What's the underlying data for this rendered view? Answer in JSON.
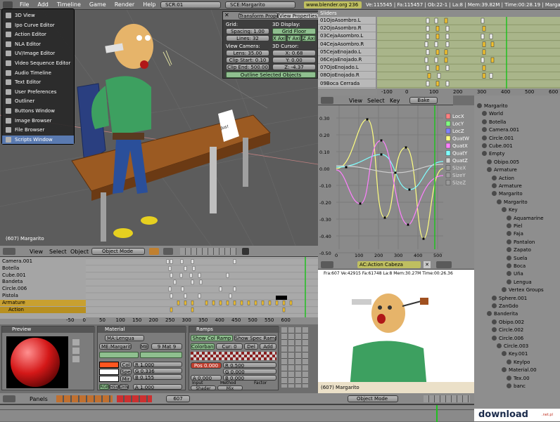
{
  "topbar": {
    "menus": [
      "File",
      "Add",
      "Timeline",
      "Game",
      "Render",
      "Help"
    ],
    "screen": "SCR:01",
    "scene": "SCE:Margarito",
    "url": "www.blender.org 236",
    "stats": "Ve:115545 | Fa:115457 | Ob:22-1 | La:8 | Mem:39.82M | Time:00:28.19 | Margarito"
  },
  "window_menu": {
    "items": [
      "3D View",
      "Ipo Curve Editor",
      "Action Editor",
      "NLA Editor",
      "UV/Image Editor",
      "Video Sequence Editor",
      "Audio Timeline",
      "Text Editor",
      "User Preferences",
      "Outliner",
      "Buttons Window",
      "Image Browser",
      "File Browser",
      "Scripts Window"
    ],
    "selected": "Scripts Window"
  },
  "viewport": {
    "frame_label": "(607) Margarito",
    "menus": [
      "View",
      "Select",
      "Object"
    ],
    "mode": "Object Mode",
    "note_text": "Jus!"
  },
  "properties_panel": {
    "tabs": [
      "Transform Prope",
      "View Properties"
    ],
    "grid_label": "Grid:",
    "spacing": "Spacing: 1.00",
    "lines": "Lines: 32",
    "display_label": "3D Display:",
    "grid_floor": "Grid Floor",
    "axes": [
      "X Axis",
      "Y Axis",
      "Z Axis"
    ],
    "camera_label": "View Camera:",
    "lens": "Lens: 35.00",
    "clip_start": "Clip Start: 0.10",
    "clip_end": "Clip End: 500.00",
    "cursor_label": "3D Cursor:",
    "cx": "X: 0.68",
    "cy": "Y: 0.00",
    "cz": "Z: -4.37",
    "outline_btn": "Outline Selected Objects"
  },
  "sliders": {
    "title": "Sliders",
    "items": [
      "01OjoAsombro.L",
      "02OjoAsombro.R",
      "03CejaAsombro.L",
      "04CejaAsombro.R",
      "05CejaEnojado.L",
      "06CejaEnojado.R",
      "07OjoEnojado.L",
      "08OjoEnojado.R",
      "09Boca Cerrada"
    ],
    "ticks": [
      "-100",
      "0",
      "100",
      "200",
      "300",
      "400",
      "500",
      "600"
    ]
  },
  "ipo": {
    "menus": [
      "View",
      "Select",
      "Key"
    ],
    "bake": "Bake",
    "channels": [
      "LocX",
      "LocY",
      "LocZ",
      "QuatW",
      "QuatX",
      "QuatY",
      "QuatZ",
      "SizeX",
      "SizeY",
      "SizeZ"
    ],
    "channel_colors": [
      "#ff8080",
      "#80ff80",
      "#8080ff",
      "#ffff80",
      "#ff80ff",
      "#80ffff",
      "#d0d0d0"
    ],
    "yticks": [
      "0.30",
      "0.20",
      "0.10",
      "0.00",
      "-0.10",
      "-0.20",
      "-0.30",
      "-0.40",
      "-0.50"
    ],
    "xticks": [
      "0",
      "100",
      "200",
      "300",
      "400",
      "500"
    ]
  },
  "action_editor": {
    "channels": [
      "Camera.001",
      "Botella",
      "Cube.001",
      "Bandeta",
      "Circle.006",
      "Pistola",
      "Armature",
      "Action"
    ],
    "ticks": [
      "-50",
      "0",
      "50",
      "100",
      "150",
      "200",
      "250",
      "300",
      "350",
      "400",
      "450",
      "500",
      "550",
      "600"
    ]
  },
  "render": {
    "action_label": "AC:Action Cabeza",
    "stats": "Fra:607 Ve:42915 Fa:61748 La:8 Mem:30.27M Time:00:26.36",
    "frame_label": "(607) Margarito",
    "mode": "Object Mode"
  },
  "outliner": {
    "items": [
      {
        "t": "Margarito",
        "d": 0
      },
      {
        "t": "World",
        "d": 1
      },
      {
        "t": "Botella",
        "d": 1
      },
      {
        "t": "Camera.001",
        "d": 1
      },
      {
        "t": "Circle.001",
        "d": 1
      },
      {
        "t": "Cube.001",
        "d": 1
      },
      {
        "t": "Empty",
        "d": 1
      },
      {
        "t": "Obipo.005",
        "d": 2
      },
      {
        "t": "Armature",
        "d": 2
      },
      {
        "t": "Action",
        "d": 3
      },
      {
        "t": "Armature",
        "d": 3
      },
      {
        "t": "Margarito",
        "d": 3
      },
      {
        "t": "Margarito",
        "d": 4
      },
      {
        "t": "Key",
        "d": 5
      },
      {
        "t": "Aquamarine",
        "d": 6
      },
      {
        "t": "Piel",
        "d": 6
      },
      {
        "t": "Faja",
        "d": 6
      },
      {
        "t": "Pantalon",
        "d": 6
      },
      {
        "t": "Zapato",
        "d": 6
      },
      {
        "t": "Suela",
        "d": 6
      },
      {
        "t": "Boca",
        "d": 6
      },
      {
        "t": "Uña",
        "d": 6
      },
      {
        "t": "Lengua",
        "d": 6
      },
      {
        "t": "Vertex Groups",
        "d": 5
      },
      {
        "t": "Sphere.001",
        "d": 3
      },
      {
        "t": "ZanGdo",
        "d": 3
      },
      {
        "t": "Banderita",
        "d": 2
      },
      {
        "t": "Obipo.002",
        "d": 3
      },
      {
        "t": "Circle.002",
        "d": 3
      },
      {
        "t": "Circle.006",
        "d": 3
      },
      {
        "t": "Circle.003",
        "d": 4
      },
      {
        "t": "Key.001",
        "d": 5
      },
      {
        "t": "Keylpo",
        "d": 6
      },
      {
        "t": "Material.00",
        "d": 5
      },
      {
        "t": "Tex.00",
        "d": 6
      },
      {
        "t": "banc",
        "d": 6
      }
    ]
  },
  "preview": {
    "title": "Preview"
  },
  "material": {
    "title": "Material",
    "ma_name": "MA:Lengua",
    "me_name": "ME:Margarito",
    "me_label": "ME",
    "count": "9 Mat 9",
    "col": "Col",
    "spe": "Spe",
    "mir": "Mir",
    "r": "R 1.000",
    "g": "G 0.336",
    "b": "B 0.155",
    "a": "A 1.000",
    "modes": [
      "RGB",
      "HSV",
      "DYN"
    ]
  },
  "ramps": {
    "title": "Ramps",
    "show_col": "Show Col Ramp",
    "show_spec": "Show Spec Ramp",
    "colorband": "Colorband",
    "cur": "Cur: 0",
    "del": "Del",
    "add": "Add",
    "pos": "Pos 0.000",
    "rr": "R 0.500",
    "gg": "G 0.000",
    "bb": "B 0.000",
    "aa": "A 0.000",
    "input": "Input",
    "method": "Method",
    "factor": "Factor",
    "shader": "Shader",
    "mix": "Mix"
  },
  "bottom": {
    "panels": "Panels",
    "frame": "607",
    "logo": "download",
    "logo_tld": ".net.pl"
  },
  "colors": {
    "bg": "#6e6e6e",
    "header": "#8a8a8a",
    "grid_green": "#a9b58a",
    "selected_key": "#f0c030"
  }
}
